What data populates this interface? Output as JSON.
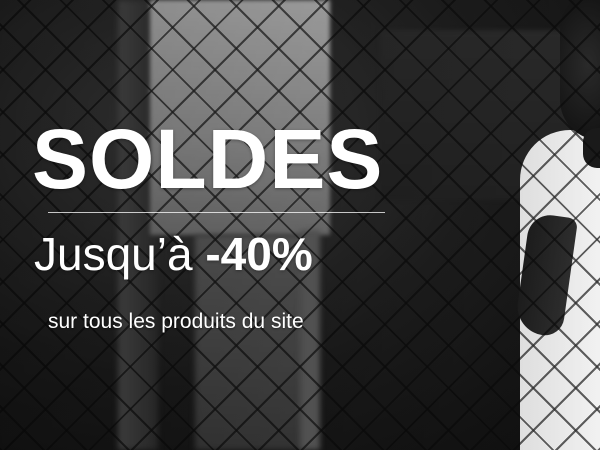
{
  "banner": {
    "headline": "SOLDES",
    "discount_prefix": "Jusqu’à",
    "discount_amount": "-40%",
    "subtext": "sur tous les produits du site"
  },
  "background": {
    "description_style": "grayscale photo behind chain-link fence",
    "colors": {
      "text": "#ffffff",
      "dark": "#1a1a1a",
      "shirt": "#f0f0f0"
    }
  }
}
